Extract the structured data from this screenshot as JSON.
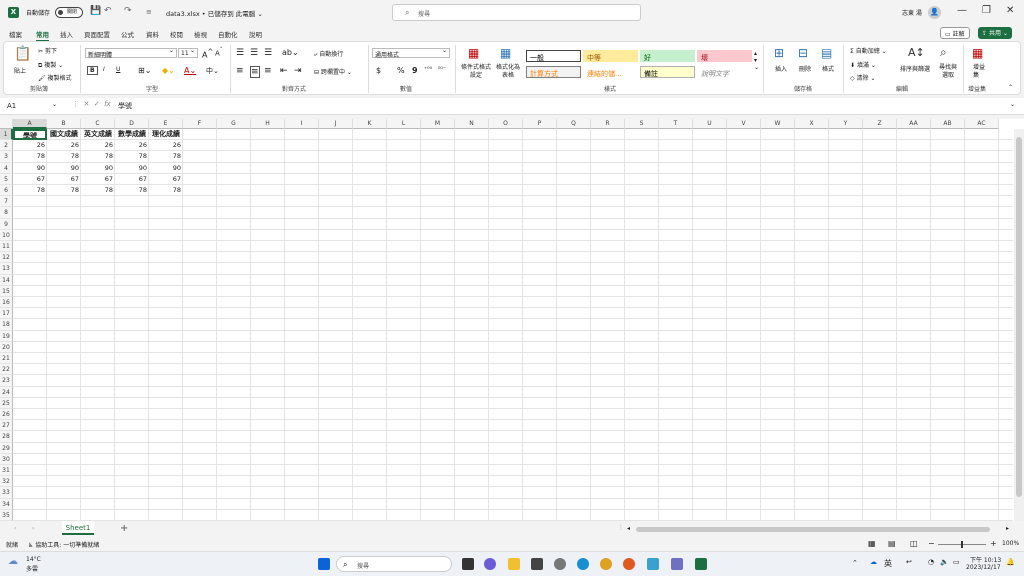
{
  "title_bar": {
    "autosave_label": "自動儲存",
    "autosave_state": "關閉",
    "doc_title": "data3.xlsx • 已儲存到 此電腦 ⌄",
    "search_placeholder": "搜尋",
    "user_name": "志東 湯"
  },
  "tabs": [
    "檔案",
    "常用",
    "插入",
    "頁面配置",
    "公式",
    "資料",
    "校閱",
    "檢視",
    "自動化",
    "說明"
  ],
  "active_tab": "常用",
  "top_buttons": {
    "comments": "註解",
    "share": "共用"
  },
  "ribbon": {
    "clipboard": {
      "paste": "貼上",
      "cut": "剪下",
      "copy": "複製",
      "format_painter": "複製格式",
      "label": "剪貼簿"
    },
    "font": {
      "font_name": "新細明體",
      "font_size": "11",
      "label": "字型",
      "bold": "B",
      "italic": "I",
      "underline": "U"
    },
    "alignment": {
      "wrap": "自動換行",
      "merge": "跨欄置中",
      "label": "對齊方式"
    },
    "number": {
      "format": "通用格式",
      "label": "數值",
      "currency": "$",
      "percent": "%",
      "comma": "9"
    },
    "styles": {
      "conditional": "條件式格式設定",
      "table": "格式化為表格",
      "cells": [
        {
          "text": "一般",
          "color": "#000000",
          "bg": "#ffffff",
          "border": "#444444"
        },
        {
          "text": "中等",
          "color": "#9c5700",
          "bg": "#ffeb9c",
          "border": "#ffeb9c"
        },
        {
          "text": "好",
          "color": "#006100",
          "bg": "#c6efce",
          "border": "#c6efce"
        },
        {
          "text": "壞",
          "color": "#9c0006",
          "bg": "#ffc7ce",
          "border": "#ffc7ce"
        },
        {
          "text": "計算方式",
          "color": "#fa7d00",
          "bg": "#f2f2f2",
          "border": "#7f7f7f"
        },
        {
          "text": "連結的儲...",
          "color": "#fa7d00",
          "bg": "#ffffff",
          "border": "#ffffff"
        },
        {
          "text": "備註",
          "color": "#000000",
          "bg": "#ffffcc",
          "border": "#b2b2b2"
        },
        {
          "text": "說明文字",
          "color": "#7f7f7f",
          "bg": "#ffffff",
          "border": "#ffffff"
        }
      ],
      "label": "樣式"
    },
    "cells": {
      "insert": "插入",
      "delete": "刪除",
      "format": "格式",
      "label": "儲存格"
    },
    "editing": {
      "autosum": "自動加總",
      "fill": "填滿",
      "clear": "清除",
      "sort": "排序與篩選",
      "find": "尋找與選取",
      "label": "編輯"
    },
    "addins": {
      "addins": "增益集",
      "label": "增益集"
    }
  },
  "formula_bar": {
    "name_box": "A1",
    "fx": "fx",
    "content": "學號"
  },
  "columns": [
    "A",
    "B",
    "C",
    "D",
    "E",
    "F",
    "G",
    "H",
    "I",
    "J",
    "K",
    "L",
    "M",
    "N",
    "O",
    "P",
    "Q",
    "R",
    "S",
    "T",
    "U",
    "V",
    "W",
    "X",
    "Y",
    "Z",
    "AA",
    "AB",
    "AC"
  ],
  "rows": [
    "1",
    "2",
    "3",
    "4",
    "5",
    "6",
    "7",
    "8",
    "9",
    "10",
    "11",
    "12",
    "13",
    "14",
    "15",
    "16",
    "17",
    "18",
    "19",
    "20",
    "21",
    "22",
    "23",
    "24",
    "25",
    "26",
    "27",
    "28",
    "29",
    "30",
    "31",
    "32",
    "33",
    "34",
    "35"
  ],
  "sheet": {
    "headers": [
      "學號",
      "國文成績",
      "英文成績",
      "數學成績",
      "理化成績"
    ],
    "data": [
      [
        "26",
        "26",
        "26",
        "26",
        "26"
      ],
      [
        "78",
        "78",
        "78",
        "78",
        "78"
      ],
      [
        "90",
        "90",
        "90",
        "90",
        "90"
      ],
      [
        "67",
        "67",
        "67",
        "67",
        "67"
      ],
      [
        "78",
        "78",
        "78",
        "78",
        "78"
      ]
    ]
  },
  "sheet_tabs": [
    "Sheet1"
  ],
  "status": {
    "ready": "就緒",
    "accessibility": "協助工具: 一切準備就緒",
    "zoom": "100%"
  },
  "taskbar": {
    "temp": "14°C",
    "weather": "多雲",
    "search": "搜尋",
    "ime": "英",
    "time": "下午 10:13",
    "date": "2023/12/17"
  }
}
